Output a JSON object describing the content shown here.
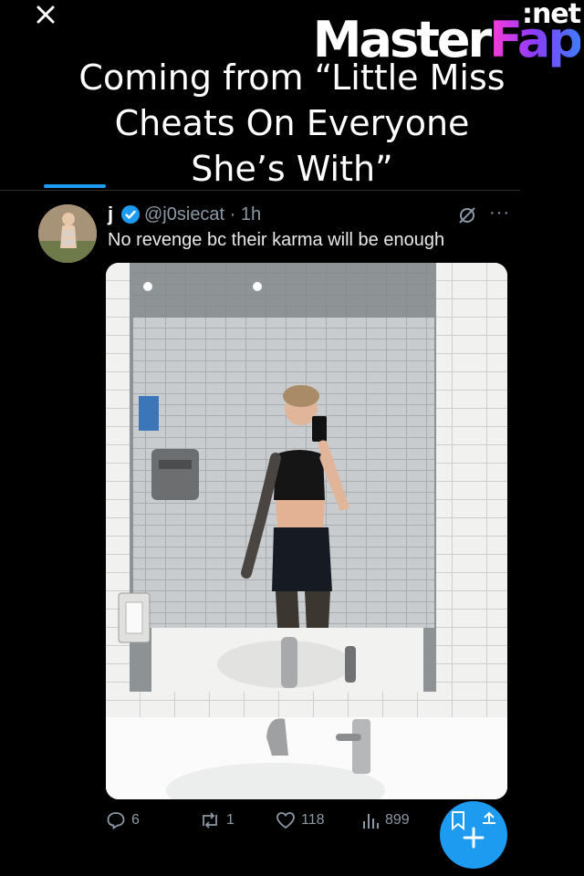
{
  "watermark": {
    "brand_main": "Master",
    "brand_accent": "Fap",
    "suffix": ":net"
  },
  "caption": {
    "lines": [
      "Coming from “Little Miss",
      "Cheats On Everyone",
      "She’s With”"
    ]
  },
  "tweet": {
    "display_name": "j",
    "handle": "@j0siecat",
    "time": "· 1h",
    "text": "No revenge bc their karma will be enough",
    "more": "···"
  },
  "actions": {
    "replies": "6",
    "reposts": "1",
    "likes": "118",
    "views": "899"
  },
  "colors": {
    "accent": "#1d9bf0",
    "muted": "#8b98a5",
    "background": "#000000"
  },
  "icons": [
    "close-icon",
    "verified-icon",
    "grok-icon",
    "reply-icon",
    "repost-icon",
    "like-icon",
    "views-icon",
    "bookmark-icon",
    "share-icon",
    "compose-icon"
  ]
}
